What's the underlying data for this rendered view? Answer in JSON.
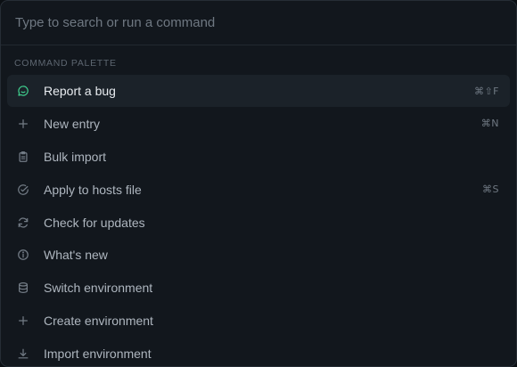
{
  "search": {
    "placeholder": "Type to search or run a command",
    "value": ""
  },
  "section": {
    "label": "COMMAND PALETTE"
  },
  "accent_color": "#3fcf8e",
  "items": [
    {
      "label": "Report a bug",
      "icon": "chat-bubble-icon",
      "shortcut": "⌘⇧F",
      "active": true
    },
    {
      "label": "New entry",
      "icon": "plus-icon",
      "shortcut": "⌘N",
      "active": false
    },
    {
      "label": "Bulk import",
      "icon": "clipboard-icon",
      "shortcut": "",
      "active": false
    },
    {
      "label": "Apply to hosts file",
      "icon": "check-circle-icon",
      "shortcut": "⌘S",
      "active": false
    },
    {
      "label": "Check for updates",
      "icon": "refresh-icon",
      "shortcut": "",
      "active": false
    },
    {
      "label": "What's new",
      "icon": "info-icon",
      "shortcut": "",
      "active": false
    },
    {
      "label": "Switch environment",
      "icon": "database-icon",
      "shortcut": "",
      "active": false
    },
    {
      "label": "Create environment",
      "icon": "plus-icon",
      "shortcut": "",
      "active": false
    },
    {
      "label": "Import environment",
      "icon": "download-icon",
      "shortcut": "",
      "active": false
    }
  ]
}
